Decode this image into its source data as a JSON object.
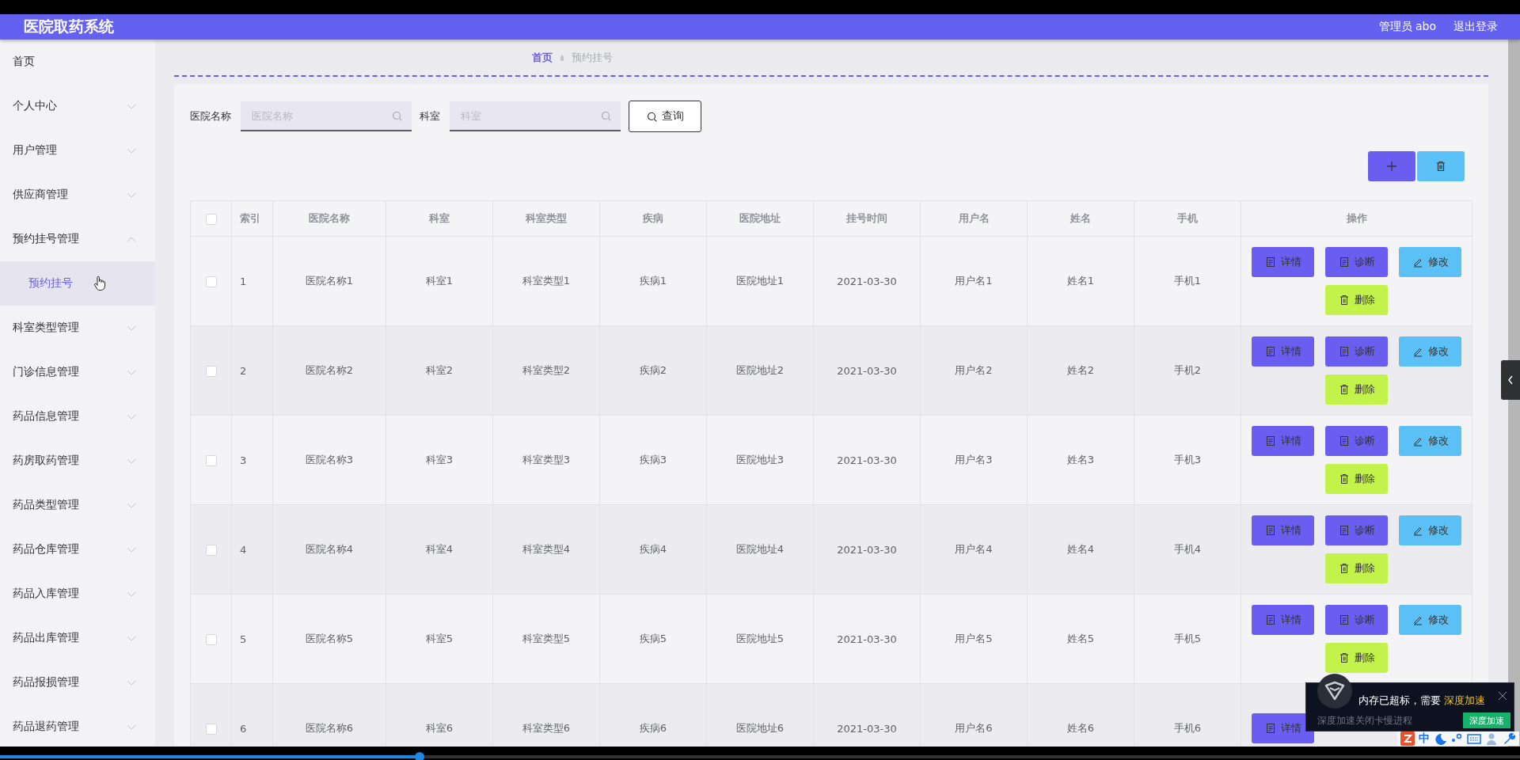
{
  "header": {
    "title": "医院取药系统",
    "user": "管理员 abo",
    "logout": "退出登录"
  },
  "sidebar": {
    "items": [
      {
        "label": "首页",
        "selected": false
      },
      {
        "label": "个人中心",
        "selected": false,
        "expanded": false
      },
      {
        "label": "用户管理",
        "selected": false,
        "expanded": false
      },
      {
        "label": "供应商管理",
        "selected": false,
        "expanded": false
      },
      {
        "label": "预约挂号管理",
        "selected": false,
        "expanded": true,
        "children": [
          {
            "label": "预约挂号",
            "selected": true
          }
        ]
      },
      {
        "label": "科室类型管理",
        "selected": false,
        "expanded": false
      },
      {
        "label": "门诊信息管理",
        "selected": false,
        "expanded": false
      },
      {
        "label": "药品信息管理",
        "selected": false,
        "expanded": false
      },
      {
        "label": "药房取药管理",
        "selected": false,
        "expanded": false
      },
      {
        "label": "药品类型管理",
        "selected": false,
        "expanded": false
      },
      {
        "label": "药品仓库管理",
        "selected": false,
        "expanded": false
      },
      {
        "label": "药品入库管理",
        "selected": false,
        "expanded": false
      },
      {
        "label": "药品出库管理",
        "selected": false,
        "expanded": false
      },
      {
        "label": "药品报损管理",
        "selected": false,
        "expanded": false
      },
      {
        "label": "药品退药管理",
        "selected": false,
        "expanded": false
      }
    ]
  },
  "breadcrumb": [
    "首页",
    "预约挂号"
  ],
  "search": {
    "fields": [
      {
        "label": "医院名称",
        "placeholder": "医院名称"
      },
      {
        "label": "科室",
        "placeholder": "科室"
      }
    ],
    "button": "查询"
  },
  "table": {
    "select_all": {
      "checked": false
    },
    "columns": [
      "索引",
      "医院名称",
      "科室",
      "科室类型",
      "疾病",
      "医院地址",
      "挂号时间",
      "用户名",
      "姓名",
      "手机",
      "操作"
    ],
    "rows": [
      {
        "checked": false,
        "cells": [
          "1",
          "医院名称1",
          "科室1",
          "科室类型1",
          "疾病1",
          "医院地址1",
          "2021-03-30",
          "用户名1",
          "姓名1",
          "手机1"
        ],
        "actions": [
          {
            "kind": "detail",
            "label": "详情"
          },
          {
            "kind": "diagnose",
            "label": "诊断"
          },
          {
            "kind": "edit",
            "label": "修改"
          },
          {
            "kind": "delete",
            "label": "删除"
          }
        ]
      },
      {
        "checked": false,
        "cells": [
          "2",
          "医院名称2",
          "科室2",
          "科室类型2",
          "疾病2",
          "医院地址2",
          "2021-03-30",
          "用户名2",
          "姓名2",
          "手机2"
        ],
        "actions": [
          {
            "kind": "detail",
            "label": "详情"
          },
          {
            "kind": "diagnose",
            "label": "诊断"
          },
          {
            "kind": "edit",
            "label": "修改"
          },
          {
            "kind": "delete",
            "label": "删除"
          }
        ]
      },
      {
        "checked": false,
        "cells": [
          "3",
          "医院名称3",
          "科室3",
          "科室类型3",
          "疾病3",
          "医院地址3",
          "2021-03-30",
          "用户名3",
          "姓名3",
          "手机3"
        ],
        "actions": [
          {
            "kind": "detail",
            "label": "详情"
          },
          {
            "kind": "diagnose",
            "label": "诊断"
          },
          {
            "kind": "edit",
            "label": "修改"
          },
          {
            "kind": "delete",
            "label": "删除"
          }
        ]
      },
      {
        "checked": false,
        "cells": [
          "4",
          "医院名称4",
          "科室4",
          "科室类型4",
          "疾病4",
          "医院地址4",
          "2021-03-30",
          "用户名4",
          "姓名4",
          "手机4"
        ],
        "actions": [
          {
            "kind": "detail",
            "label": "详情"
          },
          {
            "kind": "diagnose",
            "label": "诊断"
          },
          {
            "kind": "edit",
            "label": "修改"
          },
          {
            "kind": "delete",
            "label": "删除"
          }
        ]
      },
      {
        "checked": false,
        "cells": [
          "5",
          "医院名称5",
          "科室5",
          "科室类型5",
          "疾病5",
          "医院地址5",
          "2021-03-30",
          "用户名5",
          "姓名5",
          "手机5"
        ],
        "actions": [
          {
            "kind": "detail",
            "label": "详情"
          },
          {
            "kind": "diagnose",
            "label": "诊断"
          },
          {
            "kind": "edit",
            "label": "修改"
          },
          {
            "kind": "delete",
            "label": "删除"
          }
        ]
      },
      {
        "checked": false,
        "cells": [
          "6",
          "医院名称6",
          "科室6",
          "科室类型6",
          "疾病6",
          "医院地址6",
          "2021-03-30",
          "用户名6",
          "姓名6",
          "手机6"
        ],
        "actions": [
          {
            "kind": "detail",
            "label": "详情"
          }
        ]
      }
    ]
  },
  "notification": {
    "message": "内存已超标，需要",
    "highlight": "深度加速",
    "detail": "深度加速关闭卡慢进程",
    "button": "深度加速"
  },
  "ime_bar": {
    "mode": "中"
  },
  "video_progress": {
    "level": 0.276
  }
}
